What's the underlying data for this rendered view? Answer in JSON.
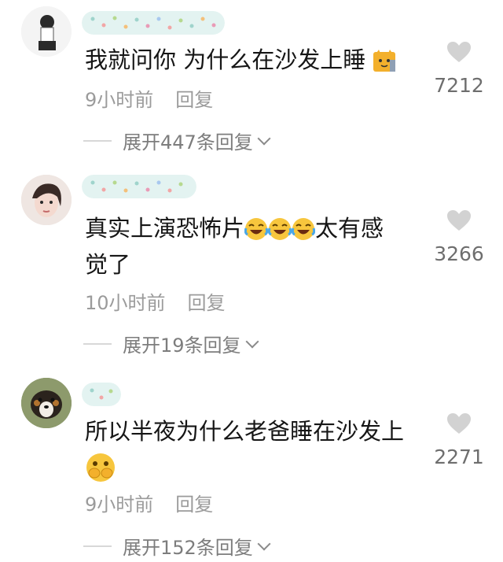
{
  "comments": [
    {
      "text": "我就问你 为什么在沙发上睡",
      "text_line2": "",
      "time": "9小时前",
      "reply_label": "回复",
      "expand_label": "展开447条回复",
      "likes": "7212",
      "emojis_after_text": [
        "cat-face-emoji"
      ]
    },
    {
      "text": "真实上演恐怖片",
      "text_suffix": "太有感",
      "text_line2": "觉了",
      "time": "10小时前",
      "reply_label": "回复",
      "expand_label": "展开19条回复",
      "likes": "3266",
      "emojis_after_text": [
        "laughing-crying-emoji",
        "laughing-crying-emoji",
        "laughing-crying-emoji"
      ]
    },
    {
      "text": "所以半夜为什么老爸睡在沙发上",
      "text_line2": "",
      "time": "9小时前",
      "reply_label": "回复",
      "expand_label": "展开152条回复",
      "likes": "2271",
      "emojis_after_text": [
        "covering-mouth-emoji"
      ]
    }
  ],
  "colors": {
    "text": "#161616",
    "meta": "#9b9b9b",
    "heart": "#d2d2d2"
  }
}
